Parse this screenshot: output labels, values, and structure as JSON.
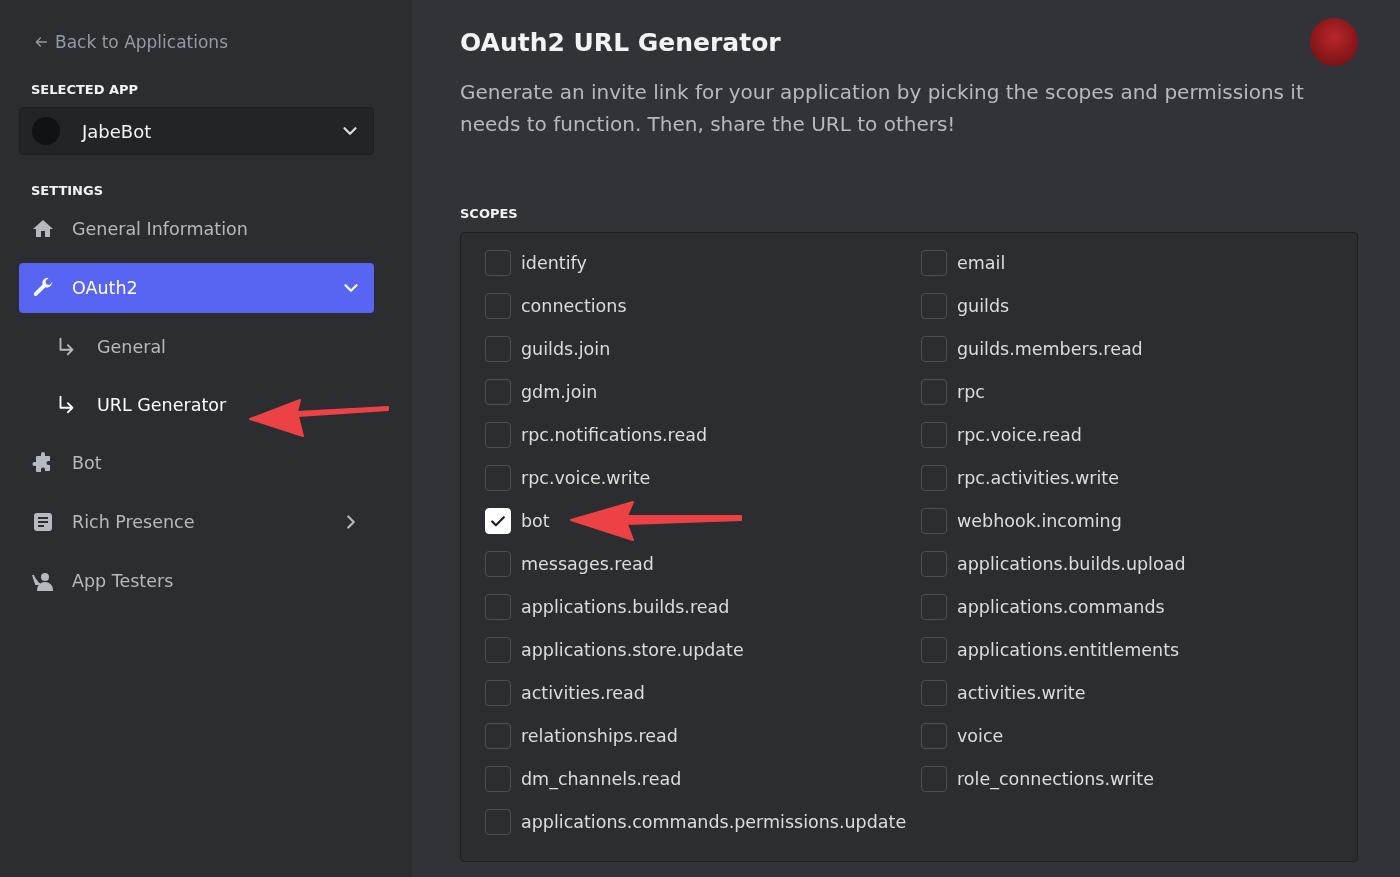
{
  "sidebar": {
    "back_link": "Back to Applications",
    "selected_app_label": "SELECTED APP",
    "app_selector": {
      "name": "JabeBot"
    },
    "settings_label": "SETTINGS",
    "items": [
      {
        "label": "General Information",
        "selected": false
      },
      {
        "label": "OAuth2",
        "selected": true,
        "expanded": true,
        "children": [
          {
            "label": "General",
            "selected": false
          },
          {
            "label": "URL Generator",
            "selected": true
          }
        ]
      },
      {
        "label": "Bot",
        "selected": false
      },
      {
        "label": "Rich Presence",
        "selected": false,
        "expanded": false
      },
      {
        "label": "App Testers",
        "selected": false
      }
    ]
  },
  "main": {
    "title": "OAuth2 URL Generator",
    "description": "Generate an invite link for your application by picking the scopes and permissions it needs to function. Then, share the URL to others!",
    "scopes_label": "SCOPES",
    "scopes": [
      {
        "label": "identify",
        "checked": false
      },
      {
        "label": "email",
        "checked": false
      },
      {
        "label": "connections",
        "checked": false
      },
      {
        "label": "guilds",
        "checked": false
      },
      {
        "label": "guilds.join",
        "checked": false
      },
      {
        "label": "guilds.members.read",
        "checked": false
      },
      {
        "label": "gdm.join",
        "checked": false
      },
      {
        "label": "rpc",
        "checked": false
      },
      {
        "label": "rpc.notifications.read",
        "checked": false
      },
      {
        "label": "rpc.voice.read",
        "checked": false
      },
      {
        "label": "rpc.voice.write",
        "checked": false
      },
      {
        "label": "rpc.activities.write",
        "checked": false
      },
      {
        "label": "bot",
        "checked": true
      },
      {
        "label": "webhook.incoming",
        "checked": false
      },
      {
        "label": "messages.read",
        "checked": false
      },
      {
        "label": "applications.builds.upload",
        "checked": false
      },
      {
        "label": "applications.builds.read",
        "checked": false
      },
      {
        "label": "applications.commands",
        "checked": false
      },
      {
        "label": "applications.store.update",
        "checked": false
      },
      {
        "label": "applications.entitlements",
        "checked": false
      },
      {
        "label": "activities.read",
        "checked": false
      },
      {
        "label": "activities.write",
        "checked": false
      },
      {
        "label": "relationships.read",
        "checked": false
      },
      {
        "label": "voice",
        "checked": false
      },
      {
        "label": "dm_channels.read",
        "checked": false
      },
      {
        "label": "role_connections.write",
        "checked": false
      },
      {
        "label": "applications.commands.permissions.update",
        "checked": false
      }
    ]
  }
}
